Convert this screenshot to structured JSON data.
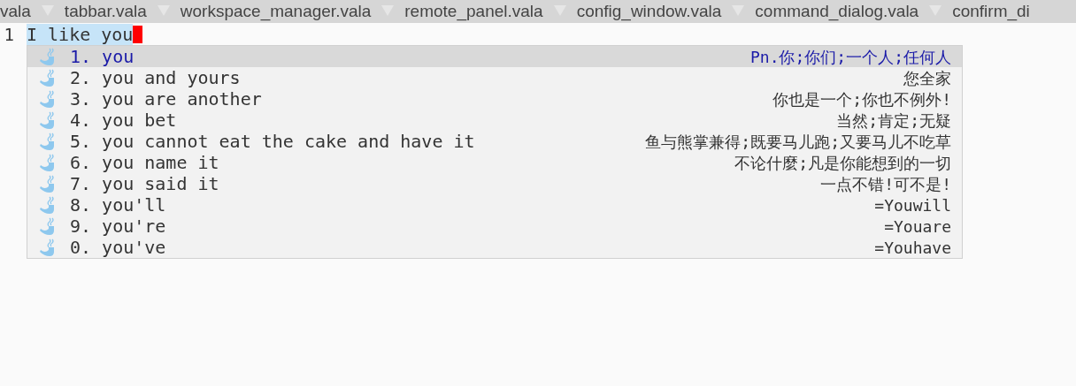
{
  "tabs": [
    {
      "label": "vala"
    },
    {
      "label": "tabbar.vala"
    },
    {
      "label": "workspace_manager.vala"
    },
    {
      "label": "remote_panel.vala"
    },
    {
      "label": "config_window.vala"
    },
    {
      "label": "command_dialog.vala"
    },
    {
      "label": "confirm_di"
    }
  ],
  "editor": {
    "line_number": "1",
    "text": "I like you",
    "text_selected": true
  },
  "completions": [
    {
      "number": "1.",
      "word": "you",
      "meaning": "Pn.你;你们;一个人;任何人",
      "selected": true
    },
    {
      "number": "2.",
      "word": "you and yours",
      "meaning": "您全家",
      "selected": false
    },
    {
      "number": "3.",
      "word": "you are another",
      "meaning": "你也是一个;你也不例外!",
      "selected": false
    },
    {
      "number": "4.",
      "word": "you bet",
      "meaning": "当然;肯定;无疑",
      "selected": false
    },
    {
      "number": "5.",
      "word": "you cannot eat the cake and have it",
      "meaning": "鱼与熊掌兼得;既要马儿跑;又要马儿不吃草",
      "selected": false
    },
    {
      "number": "6.",
      "word": "you name it",
      "meaning": "不论什麼;凡是你能想到的一切",
      "selected": false
    },
    {
      "number": "7.",
      "word": "you said it",
      "meaning": "一点不错!可不是!",
      "selected": false
    },
    {
      "number": "8.",
      "word": "you'll",
      "meaning": "=Youwill",
      "selected": false
    },
    {
      "number": "9.",
      "word": "you're",
      "meaning": "=Youare",
      "selected": false
    },
    {
      "number": "0.",
      "word": "you've",
      "meaning": "=Youhave",
      "selected": false
    }
  ]
}
